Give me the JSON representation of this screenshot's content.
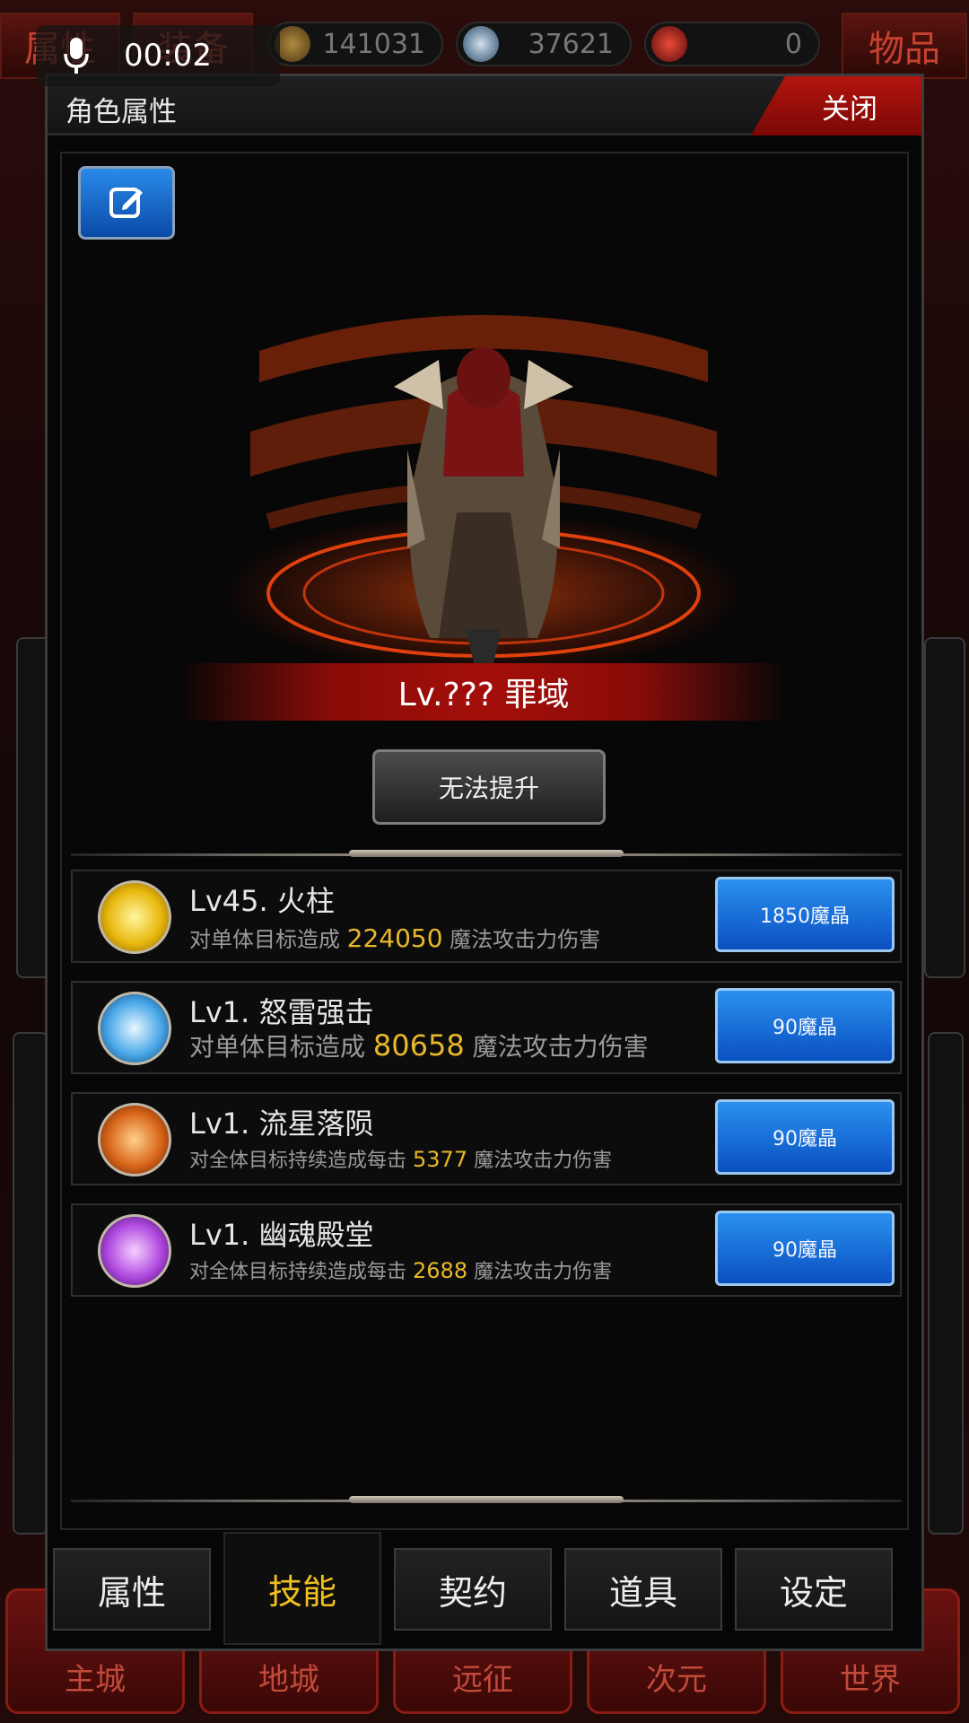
{
  "background": {
    "tabs": {
      "left_label": "属性",
      "middle_label": "装备",
      "right_label": "物品"
    },
    "resources": [
      {
        "icon": "gold-coin-icon",
        "value": "141031"
      },
      {
        "icon": "skull-icon",
        "value": "37621"
      },
      {
        "icon": "red-gem-icon",
        "value": "0"
      }
    ],
    "nav": [
      "主城",
      "地城",
      "远征",
      "次元",
      "世界"
    ]
  },
  "recording": {
    "time": "00:02"
  },
  "dialog": {
    "title": "角色属性",
    "close_label": "关闭",
    "character": {
      "level_name": "Lv.??? 罪域"
    },
    "upgrade_label": "无法提升",
    "skills": [
      {
        "icon": "fire-pillar-icon",
        "title": "Lv45. 火柱",
        "desc_prefix": "对单体目标造成",
        "value": "224050",
        "desc_suffix": "魔法攻击力伤害",
        "cost": "1850魔晶"
      },
      {
        "icon": "thunder-strike-icon",
        "title": "Lv1. 怒雷强击",
        "desc_prefix": "对单体目标造成",
        "value": "80658",
        "desc_suffix": "魔法攻击力伤害",
        "cost": "90魔晶"
      },
      {
        "icon": "meteor-icon",
        "title": "Lv1. 流星落陨",
        "desc_prefix": "对全体目标持续造成每击",
        "value": "5377",
        "desc_suffix": "魔法攻击力伤害",
        "cost": "90魔晶"
      },
      {
        "icon": "ghost-hall-icon",
        "title": "Lv1. 幽魂殿堂",
        "desc_prefix": "对全体目标持续造成每击",
        "value": "2688",
        "desc_suffix": "魔法攻击力伤害",
        "cost": "90魔晶"
      }
    ],
    "tabs": [
      {
        "label": "属性",
        "active": false
      },
      {
        "label": "技能",
        "active": true
      },
      {
        "label": "契约",
        "active": false
      },
      {
        "label": "道具",
        "active": false
      },
      {
        "label": "设定",
        "active": false
      }
    ]
  }
}
